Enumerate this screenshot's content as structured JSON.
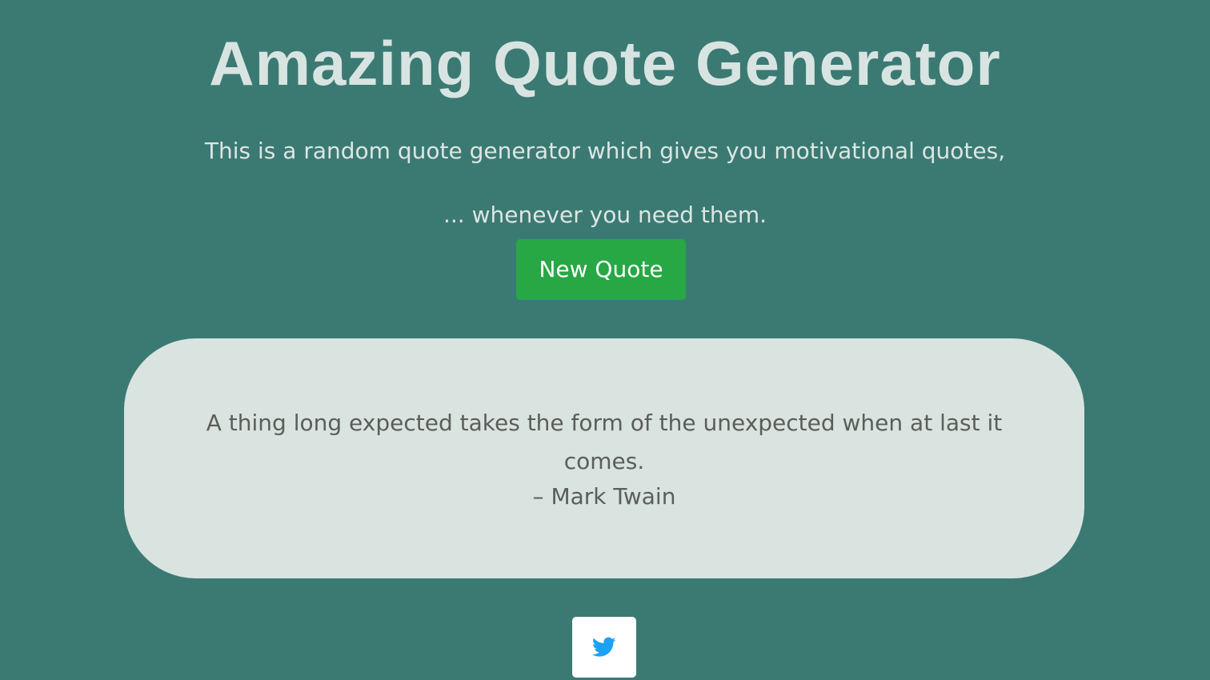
{
  "header": {
    "title": "Amazing Quote Generator",
    "subtitle_line1": "This is a random quote generator which gives you motivational quotes,",
    "subtitle_line2": "... whenever you need them."
  },
  "actions": {
    "new_quote_label": "New Quote"
  },
  "quote": {
    "text": "A thing long expected takes the form of the unexpected when at last it comes.",
    "author": "– Mark Twain"
  },
  "share": {
    "icon": "twitter-icon"
  },
  "colors": {
    "background": "#3b7a73",
    "title_text": "#d8e4e1",
    "button_green": "#28a745",
    "card_background": "#d9e4e1",
    "quote_text": "#5b5e58",
    "twitter_blue": "#1da1f2"
  }
}
